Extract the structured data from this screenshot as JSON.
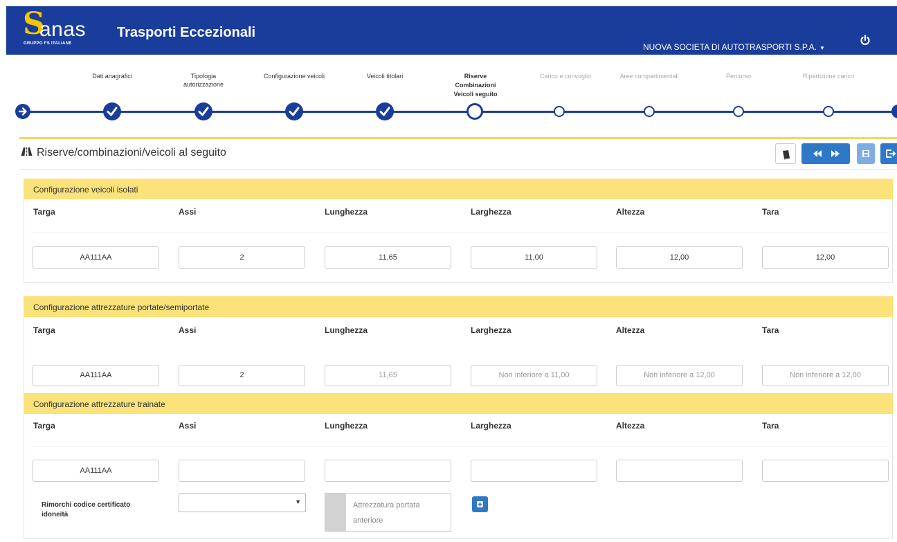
{
  "header": {
    "logo_text": "anas",
    "logo_subtext": "GRUPPO FS ITALIANE",
    "app_title": "Trasporti Eccezionali",
    "company": "NUOVA SOCIETA DI AUTOTRASPORTI S.P.A.",
    "colors": {
      "brand_blue": "#1a3d9c",
      "accent_yellow": "#f6c400"
    }
  },
  "stepper": {
    "steps": [
      {
        "label": "Dati anagrafici",
        "status": "done"
      },
      {
        "label": "Tipologia autorizzazione",
        "status": "done"
      },
      {
        "label": "Configurazione veicoli",
        "status": "done"
      },
      {
        "label": "Veicoli titolari",
        "status": "done"
      },
      {
        "label": "Riserve Combinazioni Veicoli seguito",
        "status": "current"
      },
      {
        "label": "Carico e convoglio",
        "status": "todo"
      },
      {
        "label": "Aree compartimentali",
        "status": "todo"
      },
      {
        "label": "Percorso",
        "status": "todo"
      },
      {
        "label": "Ripartizione carico",
        "status": "todo"
      }
    ]
  },
  "page": {
    "title": "Riserve/combinazioni/veicoli al seguito",
    "title_icon": "road-icon"
  },
  "toolbar": {
    "icons": [
      "book-icon",
      "step-backward-icon",
      "step-forward-icon",
      "save-icon",
      "exit-icon"
    ]
  },
  "columns": [
    "Targa",
    "Assi",
    "Lunghezza",
    "Larghezza",
    "Altezza",
    "Tara"
  ],
  "sections": {
    "isolati": {
      "title": "Configurazione veicoli isolati",
      "values": [
        "AA111AA",
        "2",
        "11,65",
        "11,00",
        "12,00",
        "12,00"
      ]
    },
    "portate": {
      "title": "Configurazione attrezzature portate/semiportate",
      "values": [
        "AA111AA",
        "2",
        "11,65"
      ],
      "placeholders": [
        "Non inferiore a 11,00",
        "Non inferiore a 12,00",
        "Non inferiore a 12,00"
      ]
    },
    "trainate": {
      "title": "Configurazione attrezzature trainate",
      "values": [
        "AA111AA",
        "",
        "",
        "",
        "",
        ""
      ],
      "rimorchi_label_1": "Rimorchi codice certificato",
      "rimorchi_label_2": "idoneità",
      "select_value": "",
      "attrezzatura_text": "Attrezzatura portata anteriore"
    }
  }
}
